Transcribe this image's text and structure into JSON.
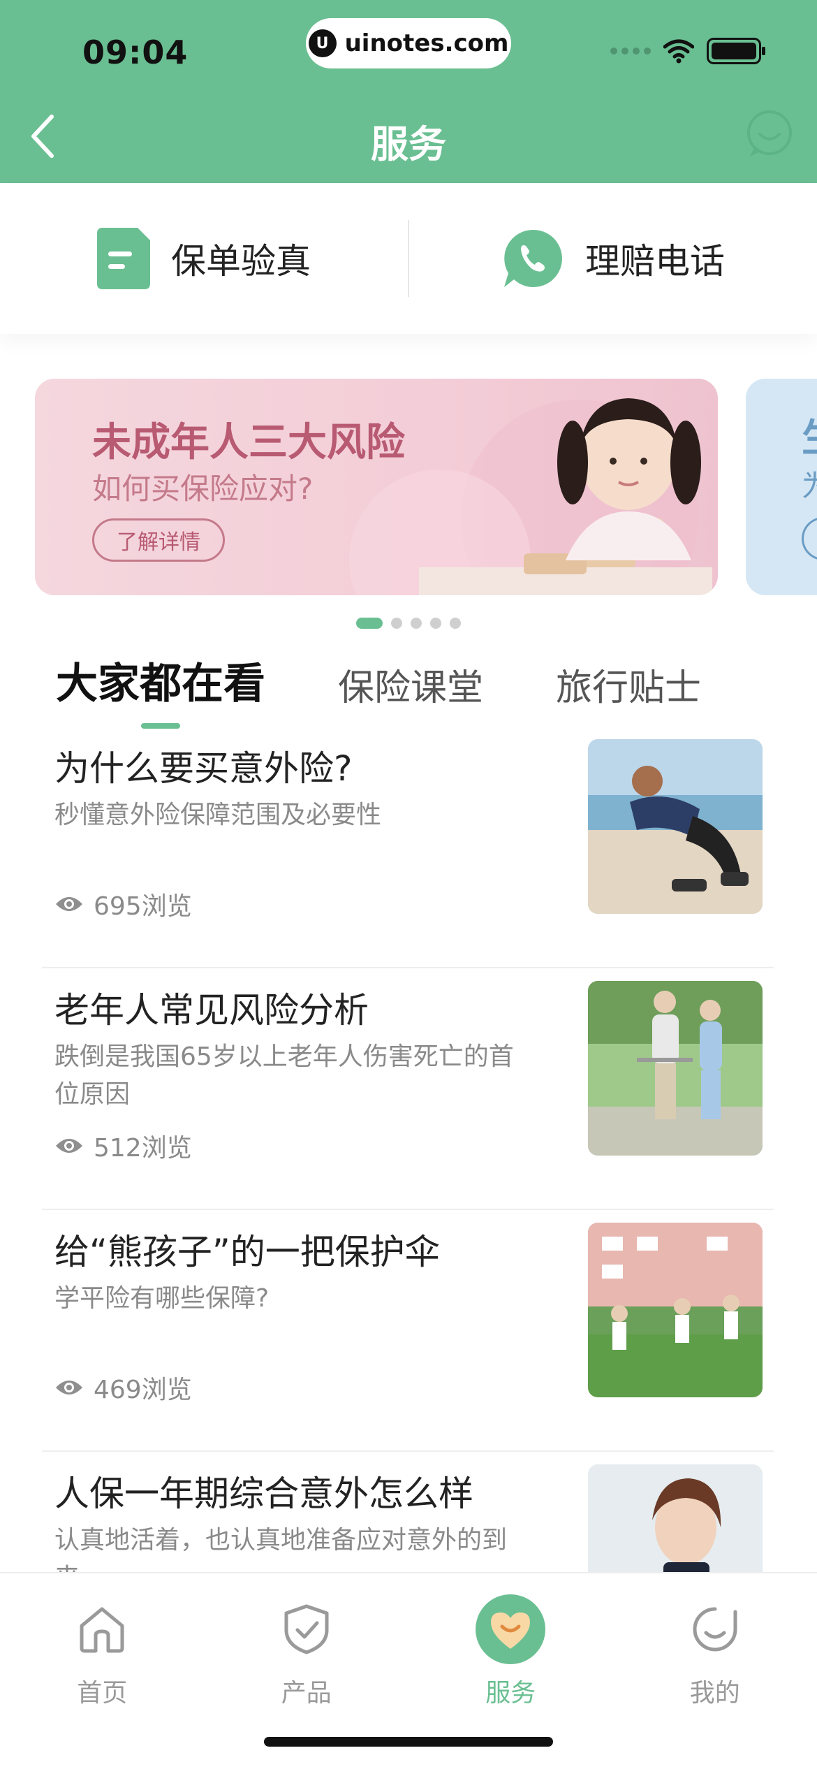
{
  "status_bar": {
    "time": "09:04",
    "url": "uinotes.com",
    "url_logo": "U"
  },
  "header": {
    "title": "服务",
    "back_icon": "chevron-left-icon",
    "chat_icon": "chat-bubble-icon"
  },
  "quick_actions": [
    {
      "label": "保单验真",
      "icon": "policy-document-icon"
    },
    {
      "label": "理赔电话",
      "icon": "phone-icon"
    }
  ],
  "banner": {
    "title": "未成年人三大风险",
    "subtitle": "如何买保险应对?",
    "button": "了解详情",
    "next_partial_title": "生",
    "next_partial_sub": "为",
    "dots_count": 5,
    "active_dot": 0
  },
  "tabs": [
    {
      "label": "大家都在看",
      "active": true
    },
    {
      "label": "保险课堂",
      "active": false
    },
    {
      "label": "旅行贴士",
      "active": false
    }
  ],
  "articles": [
    {
      "title": "为什么要买意外险?",
      "desc": "秒懂意外险保障范围及必要性",
      "views": "695浏览"
    },
    {
      "title": "老年人常见风险分析",
      "desc": "跌倒是我国65岁以上老年人伤害死亡的首位原因",
      "views": "512浏览"
    },
    {
      "title": "给“熊孩子”的一把保护伞",
      "desc": "学平险有哪些保障?",
      "views": "469浏览"
    },
    {
      "title": "人保一年期综合意外怎么样",
      "desc": "认真地活着，也认真地准备应对意外的到来",
      "views": ""
    }
  ],
  "bottom_nav": [
    {
      "label": "首页",
      "icon": "home-icon",
      "active": false
    },
    {
      "label": "产品",
      "icon": "shield-check-icon",
      "active": false
    },
    {
      "label": "服务",
      "icon": "heart-service-icon",
      "active": true
    },
    {
      "label": "我的",
      "icon": "smile-face-icon",
      "active": false
    }
  ],
  "colors": {
    "brand_green": "#6ABF92",
    "banner_pink": "#f3cdd7",
    "banner_text": "#b85a72"
  }
}
